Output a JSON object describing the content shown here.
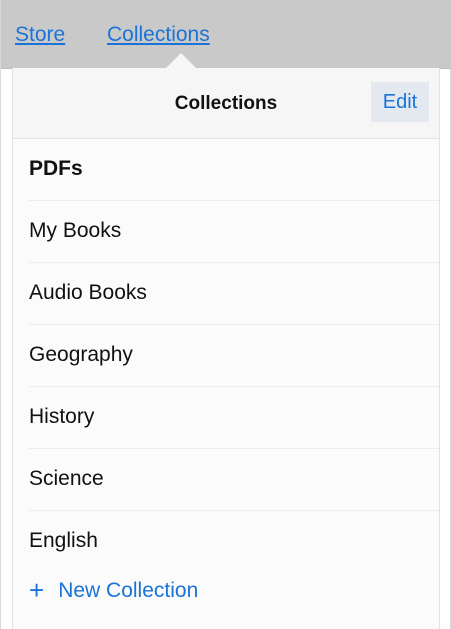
{
  "nav": {
    "store_label": "Store",
    "collections_label": "Collections"
  },
  "popover": {
    "title": "Collections",
    "edit_label": "Edit",
    "items": [
      {
        "label": "PDFs"
      },
      {
        "label": "My Books"
      },
      {
        "label": "Audio Books"
      },
      {
        "label": "Geography"
      },
      {
        "label": "History"
      },
      {
        "label": "Science"
      },
      {
        "label": "English"
      }
    ],
    "new_collection_label": "New Collection",
    "new_collection_icon": "+"
  },
  "colors": {
    "accent": "#1a73d8",
    "nav_background": "#c9c9c9",
    "edit_background": "#e4e9ef"
  }
}
